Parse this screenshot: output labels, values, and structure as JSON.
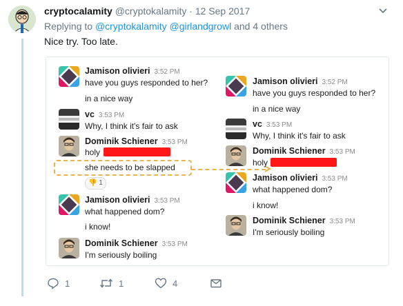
{
  "tweet": {
    "display_name": "cryptocalamity",
    "handle": "@cryptokalamity",
    "date": "· 12 Sep 2017",
    "reply_prefix": "Replying to",
    "mentions": [
      "@cryptokalamity",
      "@girlandgrowl"
    ],
    "reply_suffix": "and 4 others",
    "text": "Nice try. Too late."
  },
  "slack_left": [
    {
      "sender": "Jamison olivieri",
      "time": "3:52 PM",
      "lines": [
        "have you guys responded to her?",
        "in a nice way"
      ]
    },
    {
      "sender": "vc",
      "time": "3:53 PM",
      "lines": [
        "Why, I think it's fair to ask"
      ]
    },
    {
      "sender": "Dominik Schiener",
      "time": "3:53 PM",
      "lines": [
        "holy",
        "she needs to be slapped"
      ]
    },
    {
      "sender": "Jamison olivieri",
      "time": "3:53 PM",
      "lines": [
        "what happened dom?",
        "i know!"
      ]
    },
    {
      "sender": "Dominik Schiener",
      "time": "3:53 PM",
      "lines": [
        "I'm seriously boiling"
      ]
    }
  ],
  "reaction_count": "1",
  "slack_right": [
    {
      "sender": "Jamison olivieri",
      "time": "3:52 PM",
      "lines": [
        "have you guys responded to her?",
        "in a nice way"
      ]
    },
    {
      "sender": "vc",
      "time": "3:53 PM",
      "lines": [
        "Why, I think it's fair to ask"
      ]
    },
    {
      "sender": "Dominik Schiener",
      "time": "3:53 PM",
      "lines": [
        "holy"
      ]
    },
    {
      "sender": "Jamison olivieri",
      "time": "3:53 PM",
      "lines": [
        "what happened dom?",
        "i know!"
      ]
    },
    {
      "sender": "Dominik Schiener",
      "time": "3:53 PM",
      "lines": [
        "I'm seriously boiling"
      ]
    }
  ],
  "actions": {
    "replies": "1",
    "retweets": "1",
    "likes": "4"
  },
  "colors": {
    "mention": "#1b95e0",
    "muted": "#657786",
    "thread": "#b6def4",
    "highlight": "#e6b44a",
    "redaction": "#ff1717"
  }
}
